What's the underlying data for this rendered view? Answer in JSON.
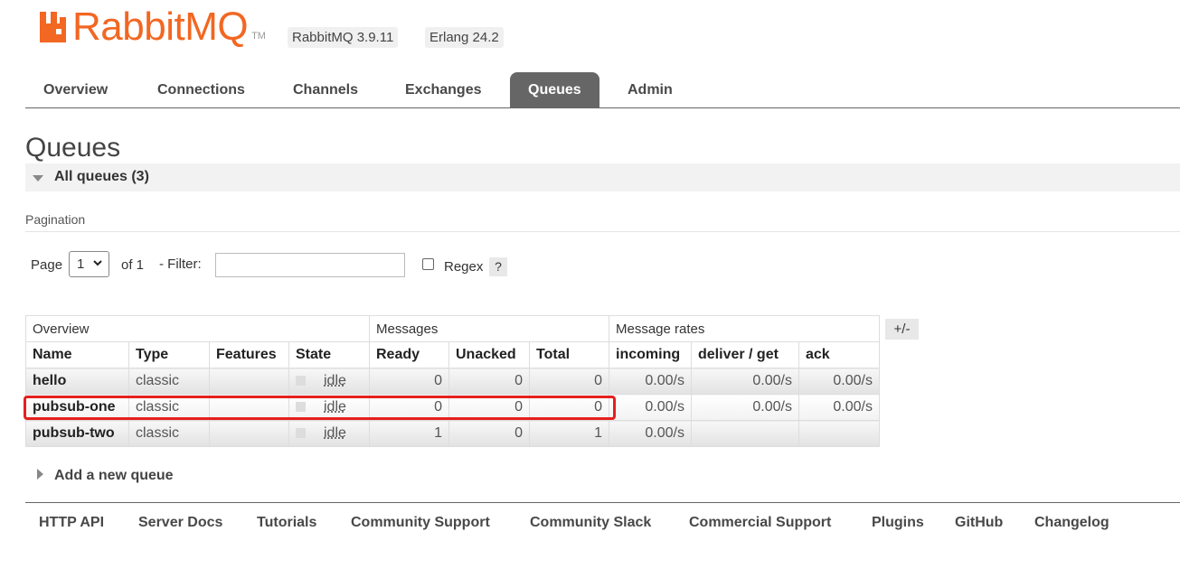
{
  "header": {
    "brand": "RabbitMQ",
    "tm": "TM",
    "brand_color": "#f26722",
    "version_rabbit": "RabbitMQ 3.9.11",
    "version_erlang": "Erlang 24.2"
  },
  "nav": {
    "tabs": [
      {
        "label": "Overview",
        "active": false
      },
      {
        "label": "Connections",
        "active": false
      },
      {
        "label": "Channels",
        "active": false
      },
      {
        "label": "Exchanges",
        "active": false
      },
      {
        "label": "Queues",
        "active": true
      },
      {
        "label": "Admin",
        "active": false
      }
    ]
  },
  "page": {
    "title": "Queues",
    "section_title": "All queues (3)",
    "pagination_label": "Pagination",
    "page_label": "Page",
    "page_value": "1",
    "of_label": "of 1",
    "filter_label": "- Filter:",
    "filter_value": "",
    "regex_label": "Regex",
    "regex_checked": false,
    "help_label": "?",
    "columns_toggle": "+/-"
  },
  "table": {
    "groups": [
      "Overview",
      "Messages",
      "Message rates"
    ],
    "columns": [
      "Name",
      "Type",
      "Features",
      "State",
      "Ready",
      "Unacked",
      "Total",
      "incoming",
      "deliver / get",
      "ack"
    ],
    "rows": [
      {
        "name": "hello",
        "type": "classic",
        "features": "",
        "state": "idle",
        "ready": "0",
        "unacked": "0",
        "total": "0",
        "incoming": "0.00/s",
        "deliver_get": "0.00/s",
        "ack": "0.00/s"
      },
      {
        "name": "pubsub-one",
        "type": "classic",
        "features": "",
        "state": "idle",
        "ready": "0",
        "unacked": "0",
        "total": "0",
        "incoming": "0.00/s",
        "deliver_get": "0.00/s",
        "ack": "0.00/s",
        "highlighted": true
      },
      {
        "name": "pubsub-two",
        "type": "classic",
        "features": "",
        "state": "idle",
        "ready": "1",
        "unacked": "0",
        "total": "1",
        "incoming": "0.00/s",
        "deliver_get": "",
        "ack": ""
      }
    ],
    "highlight_color": "#e5201e"
  },
  "add_queue": {
    "label": "Add a new queue"
  },
  "footer": {
    "links": [
      "HTTP API",
      "Server Docs",
      "Tutorials",
      "Community Support",
      "Community Slack",
      "Commercial Support",
      "Plugins",
      "GitHub",
      "Changelog"
    ]
  }
}
